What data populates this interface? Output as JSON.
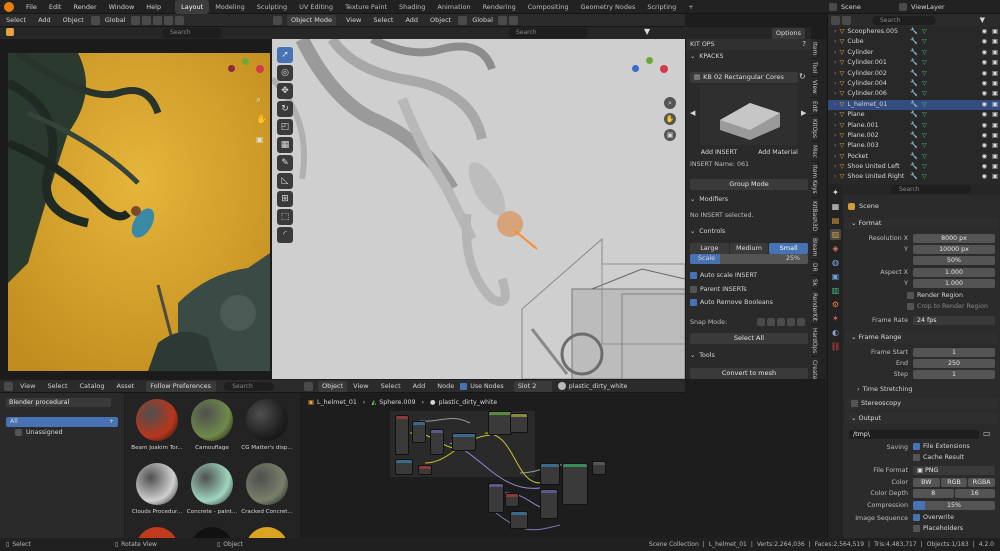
{
  "menubar": {
    "menus": [
      "File",
      "Edit",
      "Render",
      "Window",
      "Help"
    ],
    "workspaces": [
      "Layout",
      "Modeling",
      "Sculpting",
      "UV Editing",
      "Texture Paint",
      "Shading",
      "Animation",
      "Rendering",
      "Compositing",
      "Geometry Nodes",
      "Scripting"
    ],
    "add_tab": "+",
    "scene_label": "Scene",
    "viewlayer_label": "ViewLayer"
  },
  "image_editor": {
    "header_menus": [
      "Select",
      "Add",
      "Object"
    ],
    "orientation": "Global",
    "search_placeholder": "Search"
  },
  "viewport": {
    "mode": "Object Mode",
    "menus": [
      "View",
      "Select",
      "Add",
      "Object"
    ],
    "orientation": "Global",
    "search_placeholder": "Search",
    "options_label": "Options"
  },
  "kitops": {
    "title": "KIT OPS",
    "kpacks_label": "KPACKS",
    "kpack_selected": "KB 02 Rectangular Cores",
    "add_insert": "Add INSERT",
    "add_material": "Add Material",
    "insert_name": "INSERT Name: 061",
    "group_mode": "Group Mode",
    "modifiers_label": "Modifiers",
    "no_insert": "No INSERT selected.",
    "controls_label": "Controls",
    "sizes": [
      "Large",
      "Medium",
      "Small"
    ],
    "scale_label": "Scale",
    "scale_value": "25%",
    "auto_scale": "Auto scale INSERT",
    "parent_inserts": "Parent INSERTs",
    "auto_remove": "Auto Remove Booleans",
    "snap_mode": "Snap Mode:",
    "select_all": "Select All",
    "tools_label": "Tools",
    "convert_mesh": "Convert to mesh"
  },
  "n_panel_tabs": [
    "Item",
    "Tool",
    "View",
    "Edit",
    "KitOps",
    "Misc",
    "Item Keys",
    "KitBash3D",
    "Bleam",
    "DR",
    "Sk",
    "RenderKit",
    "HardOps",
    "Create",
    "Animation",
    "Retime"
  ],
  "outliner": {
    "search_placeholder": "Search",
    "items": [
      {
        "name": "Scoopheres.005",
        "selected": false
      },
      {
        "name": "Cube",
        "selected": false
      },
      {
        "name": "Cylinder",
        "selected": false
      },
      {
        "name": "Cylinder.001",
        "selected": false
      },
      {
        "name": "Cylinder.002",
        "selected": false
      },
      {
        "name": "Cylinder.004",
        "selected": false
      },
      {
        "name": "Cylinder.006",
        "selected": false
      },
      {
        "name": "L_helmet_01",
        "selected": true
      },
      {
        "name": "Plane",
        "selected": false
      },
      {
        "name": "Plane.001",
        "selected": false
      },
      {
        "name": "Plane.002",
        "selected": false
      },
      {
        "name": "Plane.003",
        "selected": false
      },
      {
        "name": "Pocket",
        "selected": false
      },
      {
        "name": "Shoe United Left",
        "selected": false
      },
      {
        "name": "Shoe United Right",
        "selected": false
      }
    ]
  },
  "properties": {
    "search_placeholder": "Search",
    "scene_label": "Scene",
    "format_label": "Format",
    "resolution_x_label": "Resolution X",
    "resolution_x": "8000 px",
    "y_label": "Y",
    "resolution_y": "10000 px",
    "percent": "50%",
    "aspect_x_label": "Aspect X",
    "aspect_x": "1.000",
    "aspect_y": "1.000",
    "render_region": "Render Region",
    "crop_region": "Crop to Render Region",
    "frame_rate_label": "Frame Rate",
    "frame_rate": "24 fps",
    "frame_range_label": "Frame Range",
    "frame_start_label": "Frame Start",
    "frame_start": "1",
    "end_label": "End",
    "frame_end": "250",
    "step_label": "Step",
    "step": "1",
    "time_stretching": "Time Stretching",
    "stereoscopy": "Stereoscopy",
    "output_label": "Output",
    "output_path": "/tmp\\",
    "saving_label": "Saving",
    "file_extensions": "File Extensions",
    "cache_result": "Cache Result",
    "file_format_label": "File Format",
    "file_format": "PNG",
    "color_label": "Color",
    "color_options": [
      "BW",
      "RGB",
      "RGBA"
    ],
    "color_depth_label": "Color Depth",
    "depth_options": [
      "8",
      "16"
    ],
    "compression_label": "Compression",
    "compression": "15%",
    "image_sequence_label": "Image Sequence",
    "overwrite": "Overwrite",
    "placeholders": "Placeholders"
  },
  "asset_browser": {
    "menus": [
      "View",
      "Select",
      "Catalog",
      "Asset"
    ],
    "follow_prefs": "Follow Preferences",
    "search_placeholder": "Search",
    "library": "Blender procedural",
    "catalog_all": "All",
    "catalog_unassigned": "Unassigned",
    "assets": [
      "Beam Joakim Tor...",
      "Camouflage",
      "CG Matter's disp...",
      "Clouds Procedur...",
      "Concrete - paint...",
      "Cracked Concret..."
    ]
  },
  "node_editor": {
    "object_label": "Object",
    "menus": [
      "View",
      "Select",
      "Add",
      "Node"
    ],
    "use_nodes": "Use Nodes",
    "slot": "Slot 2",
    "material": "plastic_dirty_white",
    "breadcrumbs": [
      "L_helmet_01",
      "Sphere.009",
      "plastic_dirty_white"
    ]
  },
  "statusbar": {
    "left": [
      "Select",
      "Rotate View",
      "Object"
    ],
    "right": [
      "Scene Collection",
      "L_helmet_01",
      "Verts:2,264,036",
      "Faces:2,564,519",
      "Tris:4,483,717",
      "Objects:1/183",
      "4.2.0"
    ]
  }
}
